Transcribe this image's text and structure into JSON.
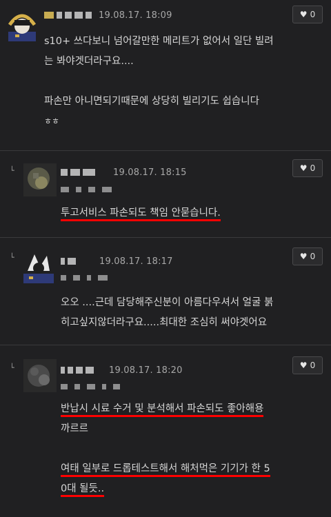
{
  "comments": [
    {
      "date": "19.08.17. 18:09",
      "likes": "0",
      "lines": [
        "s10+ 쓰다보니 넘어갈만한 메리트가 없어서 일단 빌려",
        "는 봐야겟더라구요....",
        "",
        "파손만 아니면되기때문에  상당히 빌리기도 쉽습니다",
        "ㅎㅎ"
      ]
    },
    {
      "date": "19.08.17. 18:15",
      "likes": "0",
      "lines": [
        "투고서비스 파손되도 책임 안묻습니다."
      ]
    },
    {
      "date": "19.08.17. 18:17",
      "likes": "0",
      "lines": [
        "오오 ....근데 담당해주신분이 아름다우셔서 얼굴 붉",
        "히고싶지않더라구요.....최대한 조심히 써야겟어요"
      ]
    },
    {
      "date": "19.08.17. 18:20",
      "likes": "0",
      "lines": [
        " 반납시 시료 수거 및 분석해서 파손되도 좋아해용",
        "까르르",
        "",
        "여태 일부로 드롭테스트해서 해처먹은 기기가 한 5",
        "0대 될듯.."
      ]
    }
  ],
  "icons": {
    "like": "heart-icon",
    "reply": "reply-arrow-icon"
  },
  "colors": {
    "background": "#202022",
    "underline": "#ff0000"
  }
}
